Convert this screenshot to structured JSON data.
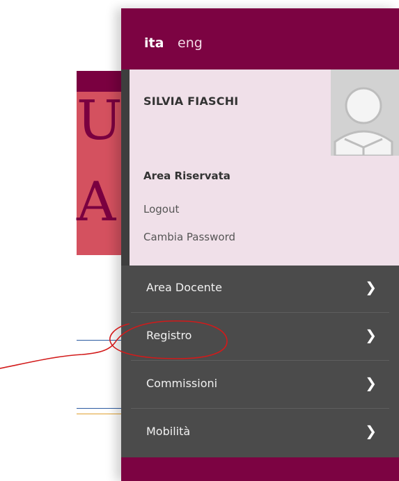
{
  "background": {
    "letters": [
      "U",
      "A"
    ]
  },
  "lang": {
    "ita": "ita",
    "eng": "eng"
  },
  "user": {
    "name": "SILVIA FIASCHI",
    "area_title": "Area Riservata",
    "logout": "Logout",
    "change_password": "Cambia Password"
  },
  "menu": {
    "items": [
      {
        "label": "Area Docente",
        "icon": "chevron-right-icon"
      },
      {
        "label": "Registro",
        "icon": "chevron-right-icon"
      },
      {
        "label": "Commissioni",
        "icon": "chevron-right-icon"
      },
      {
        "label": "Mobilità",
        "icon": "chevron-right-icon"
      }
    ]
  },
  "colors": {
    "brand": "#7c0342",
    "panel_light": "#f0e0e9",
    "menu_dark": "#4b4b4b",
    "annotation": "#d21a1a"
  }
}
